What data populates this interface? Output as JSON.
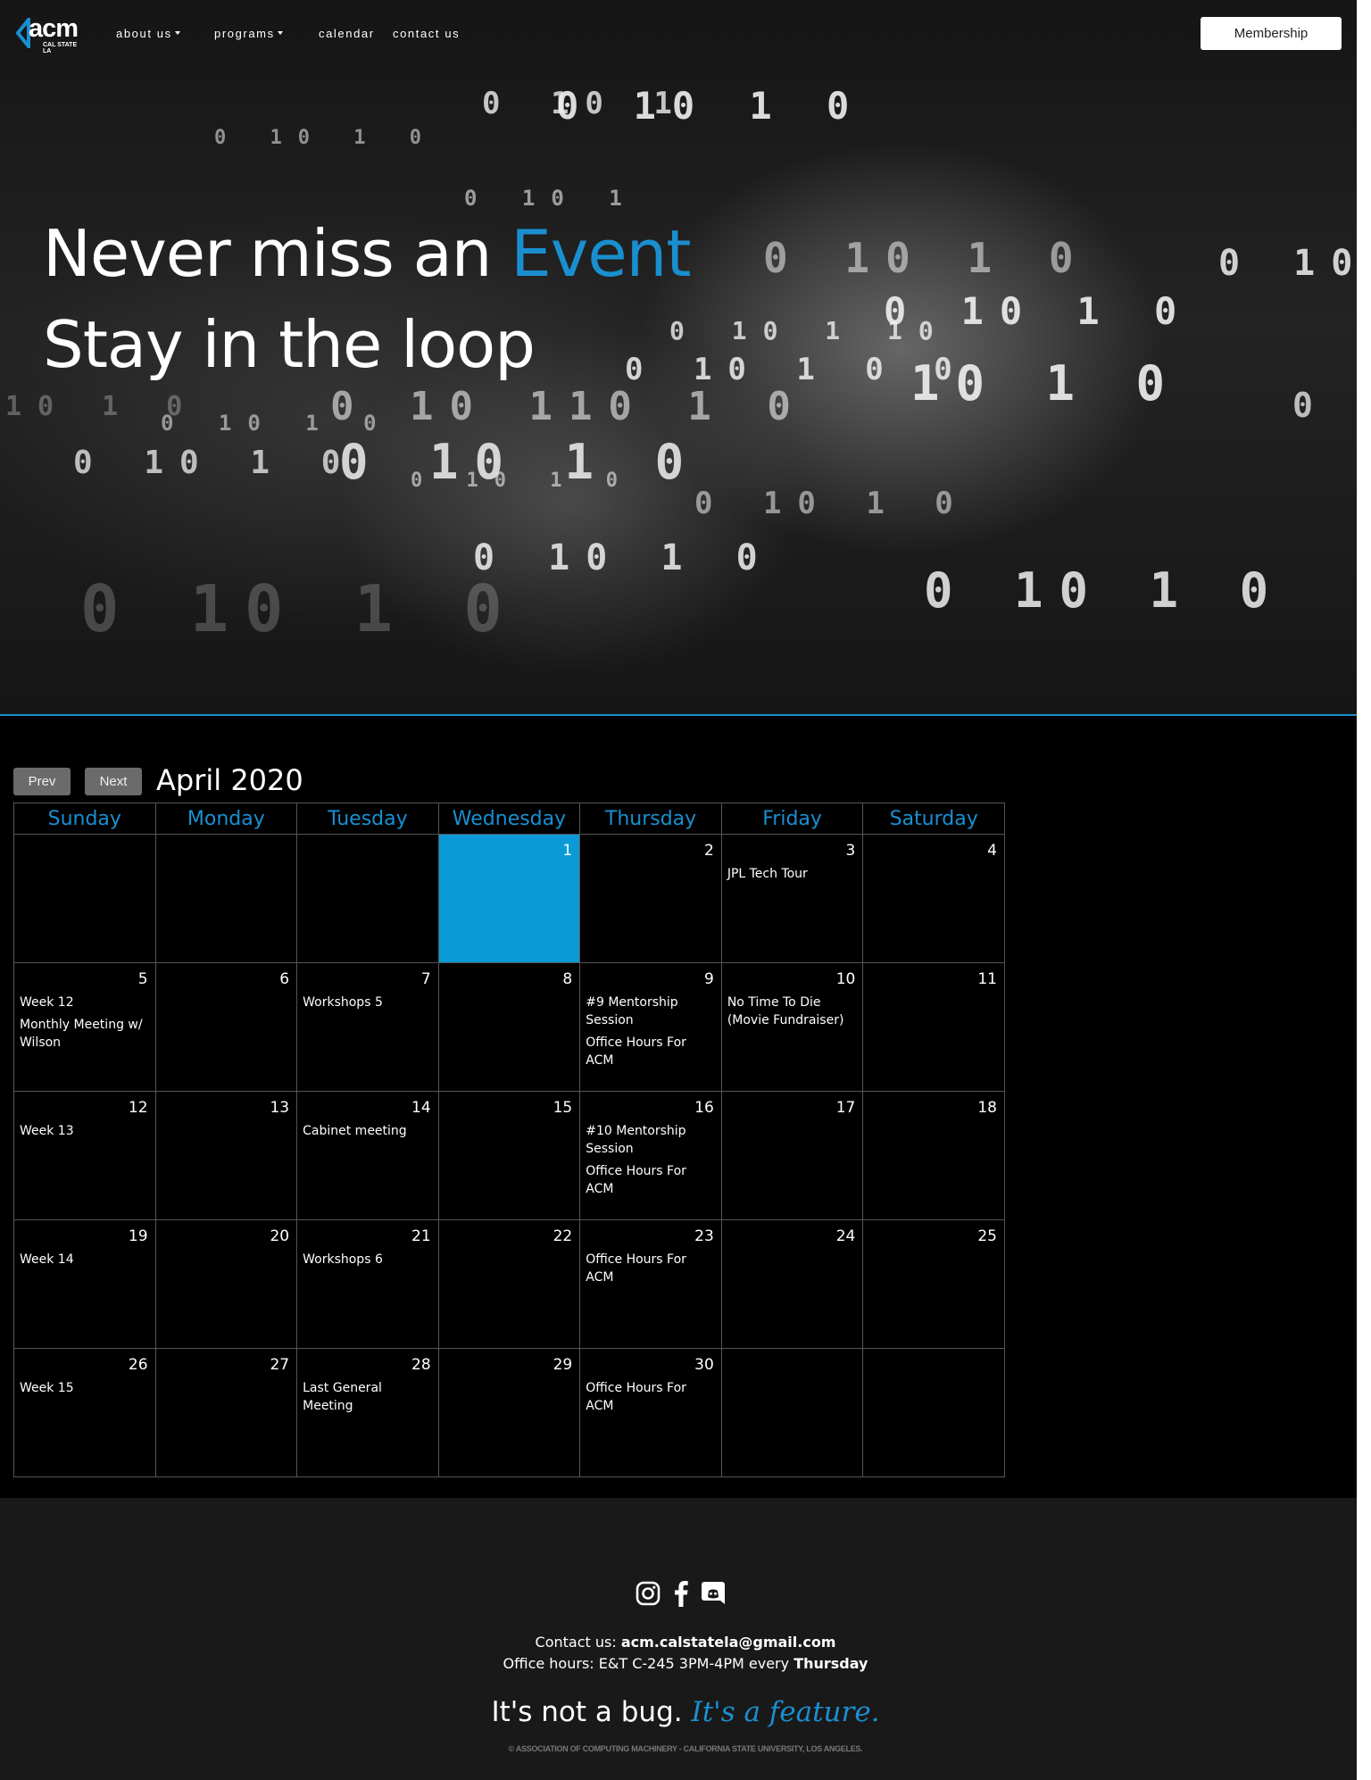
{
  "nav": {
    "logo_text": "acm",
    "logo_sub": "CAL STATE LA",
    "items": [
      {
        "label": "about us",
        "dropdown": true
      },
      {
        "label": "programs",
        "dropdown": true
      },
      {
        "label": "calendar",
        "dropdown": false
      },
      {
        "label": "contact us",
        "dropdown": false
      }
    ],
    "membership_label": "Membership"
  },
  "hero": {
    "line1_prefix": "Never miss an",
    "line1_accent": "Event",
    "line2": "Stay in the loop",
    "accent_color": "#1a8fd0"
  },
  "calendar": {
    "prev_label": "Prev",
    "next_label": "Next",
    "month_title": "April 2020",
    "weekdays": [
      "Sunday",
      "Monday",
      "Tuesday",
      "Wednesday",
      "Thursday",
      "Friday",
      "Saturday"
    ],
    "today_color": "#0a9ad8",
    "weeks": [
      [
        {
          "day": "",
          "events": []
        },
        {
          "day": "",
          "events": []
        },
        {
          "day": "",
          "events": []
        },
        {
          "day": "1",
          "events": [],
          "today": true
        },
        {
          "day": "2",
          "events": []
        },
        {
          "day": "3",
          "events": [
            "JPL Tech Tour"
          ]
        },
        {
          "day": "4",
          "events": []
        }
      ],
      [
        {
          "day": "5",
          "events": [
            "Week 12",
            "Monthly Meeting w/ Wilson"
          ]
        },
        {
          "day": "6",
          "events": []
        },
        {
          "day": "7",
          "events": [
            "Workshops 5"
          ]
        },
        {
          "day": "8",
          "events": []
        },
        {
          "day": "9",
          "events": [
            "#9 Mentorship Session",
            "Office Hours For ACM"
          ]
        },
        {
          "day": "10",
          "events": [
            "No Time To Die (Movie Fundraiser)"
          ]
        },
        {
          "day": "11",
          "events": []
        }
      ],
      [
        {
          "day": "12",
          "events": [
            "Week 13"
          ]
        },
        {
          "day": "13",
          "events": []
        },
        {
          "day": "14",
          "events": [
            "Cabinet meeting"
          ]
        },
        {
          "day": "15",
          "events": []
        },
        {
          "day": "16",
          "events": [
            "#10 Mentorship Session",
            "Office Hours For ACM"
          ]
        },
        {
          "day": "17",
          "events": []
        },
        {
          "day": "18",
          "events": []
        }
      ],
      [
        {
          "day": "19",
          "events": [
            "Week 14"
          ]
        },
        {
          "day": "20",
          "events": []
        },
        {
          "day": "21",
          "events": [
            "Workshops 6"
          ]
        },
        {
          "day": "22",
          "events": []
        },
        {
          "day": "23",
          "events": [
            "Office Hours For ACM"
          ]
        },
        {
          "day": "24",
          "events": []
        },
        {
          "day": "25",
          "events": []
        }
      ],
      [
        {
          "day": "26",
          "events": [
            "Week 15"
          ]
        },
        {
          "day": "27",
          "events": []
        },
        {
          "day": "28",
          "events": [
            "Last General Meeting"
          ]
        },
        {
          "day": "29",
          "events": []
        },
        {
          "day": "30",
          "events": [
            "Office Hours For ACM"
          ]
        },
        {
          "day": "",
          "events": []
        },
        {
          "day": "",
          "events": []
        }
      ]
    ]
  },
  "footer": {
    "social_icons": [
      "instagram-icon",
      "facebook-icon",
      "discord-icon"
    ],
    "contact_prefix": "Contact us:",
    "contact_email": "acm.calstatela@gmail.com",
    "hours_prefix": "Office hours: E&T C-245 3PM-4PM every",
    "hours_day": "Thursday",
    "tagline_prefix": "It's not a bug.",
    "tagline_accent": "It's a feature.",
    "copyright": "© ASSOCIATION OF COMPUTING MACHINERY - CALIFORNIA STATE UNIVERSITY, LOS ANGELES."
  }
}
